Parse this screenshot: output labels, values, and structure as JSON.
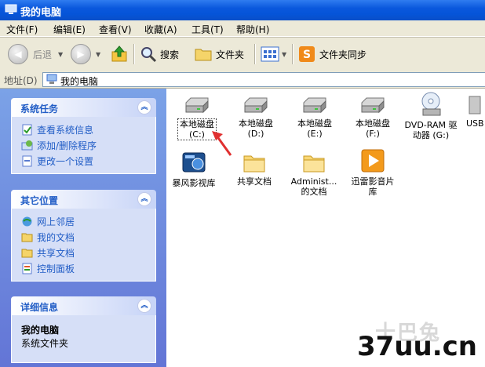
{
  "window": {
    "title": "我的电脑"
  },
  "menu": [
    "文件(F)",
    "编辑(E)",
    "查看(V)",
    "收藏(A)",
    "工具(T)",
    "帮助(H)"
  ],
  "toolbar": {
    "back": "后退",
    "search": "搜索",
    "folders": "文件夹",
    "sync": "文件夹同步"
  },
  "address": {
    "label": "地址(D)",
    "value": "我的电脑"
  },
  "panels": {
    "system_tasks": {
      "title": "系统任务",
      "items": [
        "查看系统信息",
        "添加/删除程序",
        "更改一个设置"
      ]
    },
    "other_places": {
      "title": "其它位置",
      "items": [
        "网上邻居",
        "我的文档",
        "共享文档",
        "控制面板"
      ]
    },
    "details": {
      "title": "详细信息",
      "name": "我的电脑",
      "desc": "系统文件夹"
    }
  },
  "drives": [
    {
      "line1": "本地磁盘",
      "line2": "(C:)"
    },
    {
      "line1": "本地磁盘",
      "line2": "(D:)"
    },
    {
      "line1": "本地磁盘",
      "line2": "(E:)"
    },
    {
      "line1": "本地磁盘",
      "line2": "(F:)"
    },
    {
      "line1": "DVD-RAM 驱",
      "line2": "动器 (G:)"
    },
    {
      "line1": "USB",
      "line2": ""
    }
  ],
  "folders": [
    {
      "line1": "暴风影视库",
      "line2": ""
    },
    {
      "line1": "共享文档",
      "line2": ""
    },
    {
      "line1": "Administ...",
      "line2": "的文档"
    },
    {
      "line1": "迅雷影音片",
      "line2": "库"
    }
  ],
  "watermark": {
    "text": "37uu.cn",
    "faint": "十巴兔"
  },
  "colors": {
    "title_blue": "#0a58dd",
    "pane_blue": "#6f8fe0",
    "link_blue": "#215dc6",
    "arrow_red": "#e03030"
  }
}
